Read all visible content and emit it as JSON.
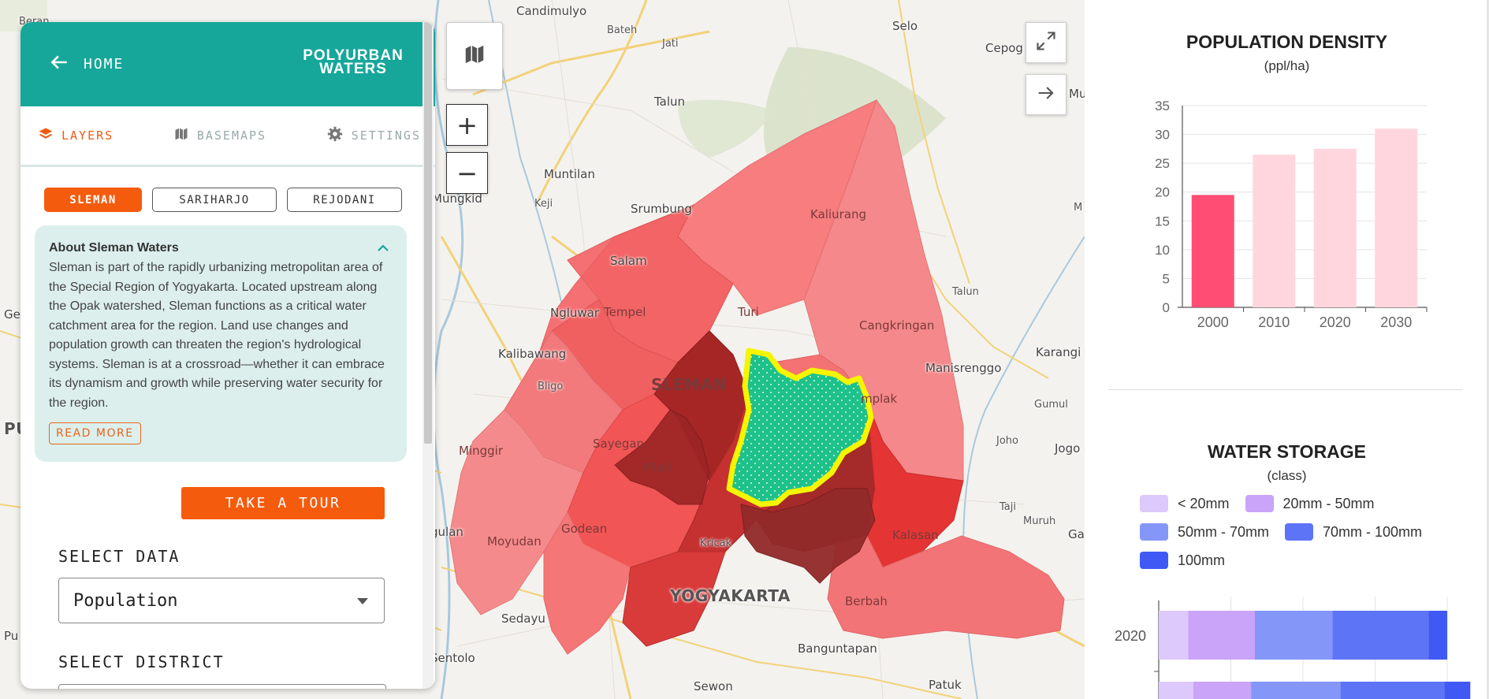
{
  "map": {
    "places": [
      {
        "name": "Candimulyo",
        "cls": ""
      },
      {
        "name": "Bateh",
        "cls": "small"
      },
      {
        "name": "Jati",
        "cls": "small"
      },
      {
        "name": "Selo",
        "cls": ""
      },
      {
        "name": "Cepog",
        "cls": ""
      },
      {
        "name": "Talun",
        "cls": ""
      },
      {
        "name": "Muntilan",
        "cls": ""
      },
      {
        "name": "Srumbung",
        "cls": ""
      },
      {
        "name": "Mungkid",
        "cls": ""
      },
      {
        "name": "Keji",
        "cls": "small"
      },
      {
        "name": "Salam",
        "cls": ""
      },
      {
        "name": "Ngluwar",
        "cls": ""
      },
      {
        "name": "Kalibawang",
        "cls": ""
      },
      {
        "name": "Bligo",
        "cls": "small"
      },
      {
        "name": "Kaliurang",
        "cls": "onpoly"
      },
      {
        "name": "Tempel",
        "cls": "onpoly"
      },
      {
        "name": "Turi",
        "cls": "onpoly"
      },
      {
        "name": "Cangkringan",
        "cls": "onpoly"
      },
      {
        "name": "Talun",
        "cls": "small"
      },
      {
        "name": "Karangi",
        "cls": ""
      },
      {
        "name": "SLEMAN",
        "cls": "big onpoly"
      },
      {
        "name": "mplak",
        "cls": "onpoly"
      },
      {
        "name": "Manisrenggo",
        "cls": ""
      },
      {
        "name": "Gumul",
        "cls": "small"
      },
      {
        "name": "Minggir",
        "cls": "onpoly"
      },
      {
        "name": "Sayegan",
        "cls": "onpoly"
      },
      {
        "name": "Mlati",
        "cls": "onpoly"
      },
      {
        "name": "Joho",
        "cls": "small"
      },
      {
        "name": "Jogo",
        "cls": ""
      },
      {
        "name": "Taji",
        "cls": "small"
      },
      {
        "name": "Muruh",
        "cls": "small"
      },
      {
        "name": "Godean",
        "cls": "onpoly"
      },
      {
        "name": "Moyudan",
        "cls": "onpoly"
      },
      {
        "name": "gulan",
        "cls": ""
      },
      {
        "name": "Kricak",
        "cls": "small"
      },
      {
        "name": "Kalasan",
        "cls": "onpoly"
      },
      {
        "name": "YOGYAKARTA",
        "cls": "big"
      },
      {
        "name": "Sedayu",
        "cls": ""
      },
      {
        "name": "Berbah",
        "cls": "onpoly"
      },
      {
        "name": "Banguntapan",
        "cls": ""
      },
      {
        "name": "Sentolo",
        "cls": ""
      },
      {
        "name": "Sewon",
        "cls": ""
      },
      {
        "name": "Patuk",
        "cls": ""
      },
      {
        "name": "Ge",
        "cls": ""
      },
      {
        "name": "PU",
        "cls": "big"
      },
      {
        "name": "Pu",
        "cls": ""
      },
      {
        "name": "Beran",
        "cls": "small"
      },
      {
        "name": "Ga",
        "cls": ""
      },
      {
        "name": "Mu",
        "cls": ""
      },
      {
        "name": "M",
        "cls": "small"
      }
    ]
  },
  "sidebar": {
    "home_label": "HOME",
    "logo_line1": "POLYURBAN",
    "logo_line2": "WATERS",
    "tabs": [
      {
        "label": "LAYERS",
        "icon": "layers-icon",
        "active": true
      },
      {
        "label": "BASEMAPS",
        "icon": "map-icon",
        "active": false
      },
      {
        "label": "SETTINGS",
        "icon": "gear-icon",
        "active": false
      }
    ],
    "regions": [
      "SLEMAN",
      "SARIHARJO",
      "REJODANI"
    ],
    "about_title": "About Sleman Waters",
    "about_text": "Sleman is part of the rapidly urbanizing metropolitan area of the Special Region of Yogyakarta. Located upstream along the Opak watershed, Sleman functions as a critical water catchment area for the region. Land use changes and population growth can threaten the region's hydrological systems. Sleman is at a crossroad—whether it can embrace its dynamism and growth while preserving water security for the region.",
    "read_more": "READ MORE",
    "tour_label": "TAKE A TOUR",
    "select_data_label": "SELECT DATA",
    "select_data_value": "Population",
    "select_district_label": "SELECT DISTRICT"
  },
  "colors": {
    "teal": "#16a79a",
    "orange": "#f55b0d",
    "highlight_bar": "#ff4d73",
    "pale_bar": "#ffd6de"
  },
  "chart_data": [
    {
      "type": "bar",
      "title": "POPULATION DENSITY",
      "subtitle": "(ppl/ha)",
      "categories": [
        "2000",
        "2010",
        "2020",
        "2030"
      ],
      "values": [
        19.5,
        26.5,
        27.5,
        31
      ],
      "ylim": [
        0,
        35
      ],
      "yticks": [
        0,
        5,
        10,
        15,
        20,
        25,
        30,
        35
      ],
      "grid": true
    },
    {
      "type": "bar",
      "title": "WATER STORAGE",
      "subtitle": "(class)",
      "legend": [
        {
          "label": "< 20mm",
          "color": "#ddc9fb"
        },
        {
          "label": "20mm - 50mm",
          "color": "#c9a4f8"
        },
        {
          "label": "50mm - 70mm",
          "color": "#8497f8"
        },
        {
          "label": "70mm - 100mm",
          "color": "#5d74f6"
        },
        {
          "label": "100mm",
          "color": "#4059f4"
        }
      ],
      "categories": [
        "2020"
      ],
      "series": [
        {
          "name": "< 20mm",
          "values": [
            8
          ]
        },
        {
          "name": "20mm - 50mm",
          "values": [
            18
          ]
        },
        {
          "name": "50mm - 70mm",
          "values": [
            21
          ]
        },
        {
          "name": "70mm - 100mm",
          "values": [
            26
          ]
        },
        {
          "name": "100mm",
          "values": [
            5
          ]
        }
      ]
    }
  ]
}
